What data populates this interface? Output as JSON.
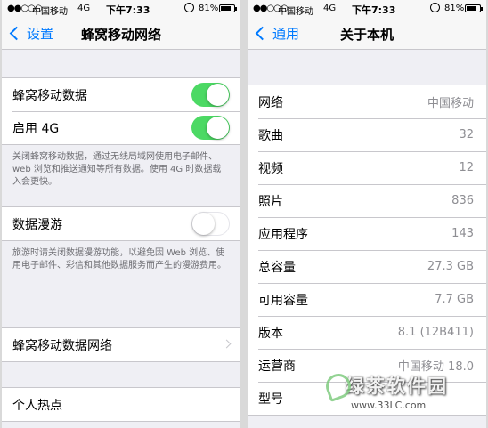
{
  "left": {
    "status": {
      "carrier": "中国移动",
      "network": "4G",
      "time": "下午7:33",
      "battery": "81%",
      "battery_fraction": 0.81
    },
    "nav": {
      "back": "设置",
      "title": "蜂窝移动网络"
    },
    "rows": {
      "cellular_data": "蜂窝移动数据",
      "enable_4g": "启用 4G",
      "footnote1": "关闭蜂窝移动数据，通过无线局域网使用电子邮件、web 浏览和推送通知等所有数据。使用 4G 时数据载入会更快。",
      "roaming": "数据漫游",
      "footnote2": "旅游时请关闭数据漫游功能，以避免因 Web 浏览、使用电子邮件、彩信和其他数据服务而产生的漫游费用。",
      "cellular_network": "蜂窝移动数据网络",
      "hotspot": "个人热点"
    },
    "toggles": {
      "cellular_data": true,
      "enable_4g": true,
      "roaming": false
    }
  },
  "right": {
    "status": {
      "carrier": "中国移动",
      "network": "4G",
      "time": "下午7:33",
      "battery": "81%",
      "battery_fraction": 0.81
    },
    "nav": {
      "back": "通用",
      "title": "关于本机"
    },
    "rows": [
      {
        "label": "网络",
        "value": "中国移动"
      },
      {
        "label": "歌曲",
        "value": "32"
      },
      {
        "label": "视频",
        "value": "12"
      },
      {
        "label": "照片",
        "value": "836"
      },
      {
        "label": "应用程序",
        "value": "143"
      },
      {
        "label": "总容量",
        "value": "27.3 GB"
      },
      {
        "label": "可用容量",
        "value": "7.7 GB"
      },
      {
        "label": "版本",
        "value": "8.1 (12B411)"
      },
      {
        "label": "运营商",
        "value": "中国移动 18.0"
      },
      {
        "label": "型号",
        "value": ""
      }
    ]
  },
  "watermark": {
    "brand": "绿茶软件园",
    "url": "www.33LC.com"
  },
  "colors": {
    "accent": "#007aff",
    "switch_on": "#4cd964",
    "background": "#efeff4",
    "secondary_text": "#8e8e93"
  }
}
